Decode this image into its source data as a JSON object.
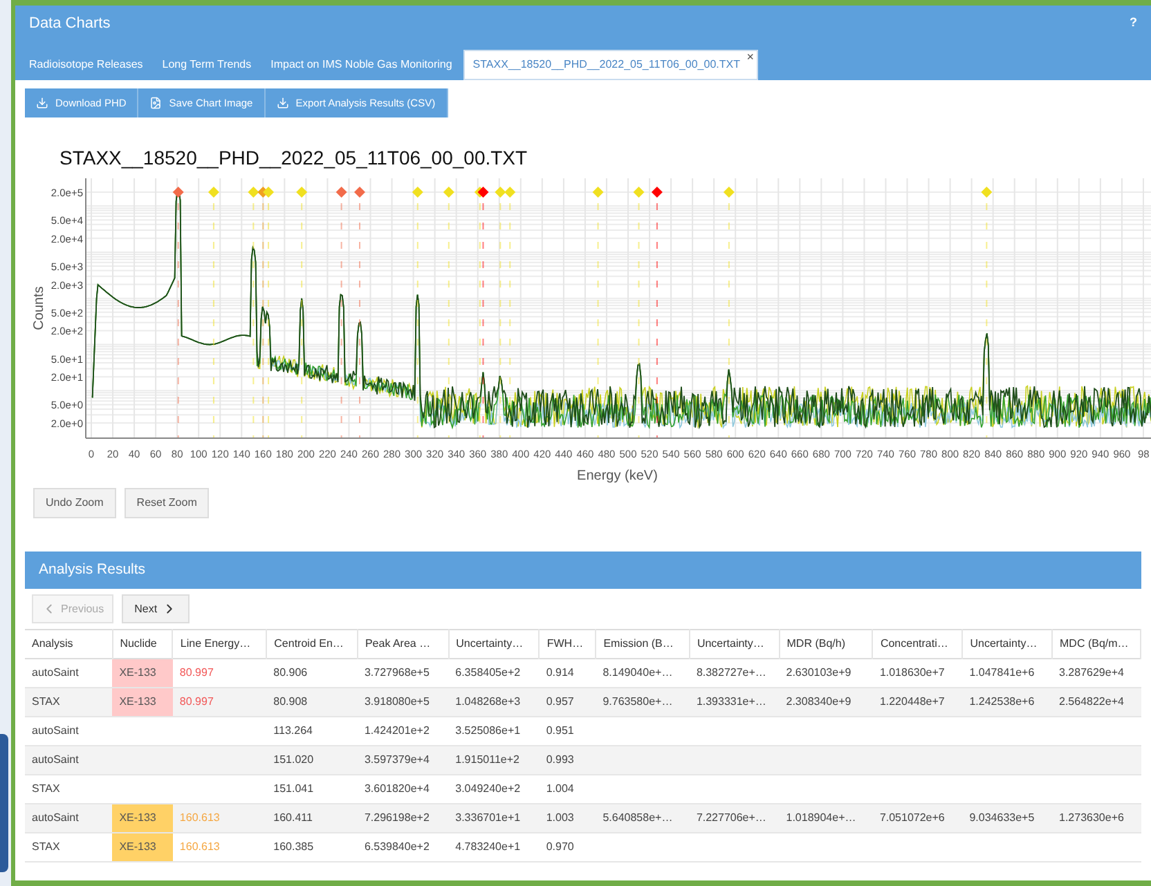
{
  "panel": {
    "title": "Data Charts",
    "help": "?"
  },
  "tabs": [
    {
      "label": "Radioisotope Releases",
      "selected": false
    },
    {
      "label": "Long Term Trends",
      "selected": false
    },
    {
      "label": "Impact on IMS Noble Gas Monitoring",
      "selected": false
    },
    {
      "label": "STAXX__18520__PHD__2022_05_11T06_00_00.TXT",
      "selected": true,
      "close": "×"
    }
  ],
  "toolbar": [
    {
      "label": "Download PHD",
      "kind": "download"
    },
    {
      "label": "Save Chart Image",
      "kind": "image"
    },
    {
      "label": "Export Analysis Results (CSV)",
      "kind": "download"
    }
  ],
  "chart": {
    "title": "STAXX__18520__PHD__2022_05_11T06_00_00.TXT",
    "xlabel": "Energy (keV)",
    "ylabel": "Counts",
    "xticks": [
      "0",
      "20",
      "40",
      "60",
      "80",
      "100",
      "120",
      "140",
      "160",
      "180",
      "200",
      "220",
      "240",
      "260",
      "280",
      "300",
      "320",
      "340",
      "360",
      "380",
      "400",
      "420",
      "440",
      "460",
      "480",
      "500",
      "520",
      "540",
      "560",
      "580",
      "600",
      "620",
      "640",
      "660",
      "680",
      "700",
      "720",
      "740",
      "760",
      "780",
      "800",
      "820",
      "840",
      "860",
      "880",
      "900",
      "920",
      "940",
      "960",
      "98"
    ],
    "yticks": [
      "2.0e+5",
      "5.0e+4",
      "2.0e+4",
      "5.0e+3",
      "2.0e+3",
      "5.0e+2",
      "2.0e+2",
      "5.0e+1",
      "2.0e+1",
      "5.0e+0",
      "2.0e+0"
    ],
    "zoom_buttons": [
      "Undo Zoom",
      "Reset Zoom"
    ]
  },
  "results": {
    "title": "Analysis Results",
    "pager": [
      {
        "label": "Previous",
        "disabled": true,
        "kind": "prev"
      },
      {
        "label": "Next",
        "disabled": false,
        "kind": "next"
      }
    ],
    "columns": [
      "Analysis",
      "Nuclide",
      "Line Energy…",
      "Centroid En…",
      "Peak Area …",
      "Uncertainty…",
      "FWH…",
      "Emission (B…",
      "Uncertainty…",
      "MDR (Bq/h)",
      "Concentrati…",
      "Uncertainty…",
      "MDC (Bq/m…"
    ],
    "rows": [
      {
        "cells": [
          "autoSaint",
          {
            "text": "XE-133",
            "color": "#ffc9c9"
          },
          {
            "text": "80.997",
            "color": "#f25757"
          },
          "80.906",
          "3.727968e+5",
          "6.358405e+2",
          "0.914",
          "8.149040e+…",
          "8.382727e+…",
          "2.630103e+9",
          "1.018630e+7",
          "1.047841e+6",
          "3.287629e+4"
        ]
      },
      {
        "cells": [
          "STAX",
          {
            "text": "XE-133",
            "color": "#ffc9c9"
          },
          {
            "text": "80.997",
            "color": "#f25757"
          },
          "80.908",
          "3.918080e+5",
          "1.048268e+3",
          "0.957",
          "9.763580e+…",
          "1.393331e+…",
          "2.308340e+9",
          "1.220448e+7",
          "1.242538e+6",
          "2.564822e+4"
        ]
      },
      {
        "cells": [
          "autoSaint",
          "",
          "",
          "113.264",
          "1.424201e+2",
          "3.525086e+1",
          "0.951",
          "",
          "",
          "",
          "",
          "",
          ""
        ]
      },
      {
        "cells": [
          "autoSaint",
          "",
          "",
          "151.020",
          "3.597379e+4",
          "1.915011e+2",
          "0.993",
          "",
          "",
          "",
          "",
          "",
          ""
        ]
      },
      {
        "cells": [
          "STAX",
          "",
          "",
          "151.041",
          "3.601820e+4",
          "3.049240e+2",
          "1.004",
          "",
          "",
          "",
          "",
          "",
          ""
        ]
      },
      {
        "cells": [
          "autoSaint",
          {
            "text": "XE-133",
            "color": "#ffd166"
          },
          {
            "text": "160.613",
            "color": "#f5a742"
          },
          "160.411",
          "7.296198e+2",
          "3.336701e+1",
          "1.003",
          "5.640858e+…",
          "7.227706e+…",
          "1.018904e+…",
          "7.051072e+6",
          "9.034633e+5",
          "1.273630e+6"
        ]
      },
      {
        "cells": [
          "STAX",
          {
            "text": "XE-133",
            "color": "#ffd166"
          },
          {
            "text": "160.613",
            "color": "#f5a742"
          },
          "160.385",
          "6.539840e+2",
          "4.783240e+1",
          "0.970",
          "",
          "",
          "",
          "",
          "",
          ""
        ]
      }
    ]
  }
}
